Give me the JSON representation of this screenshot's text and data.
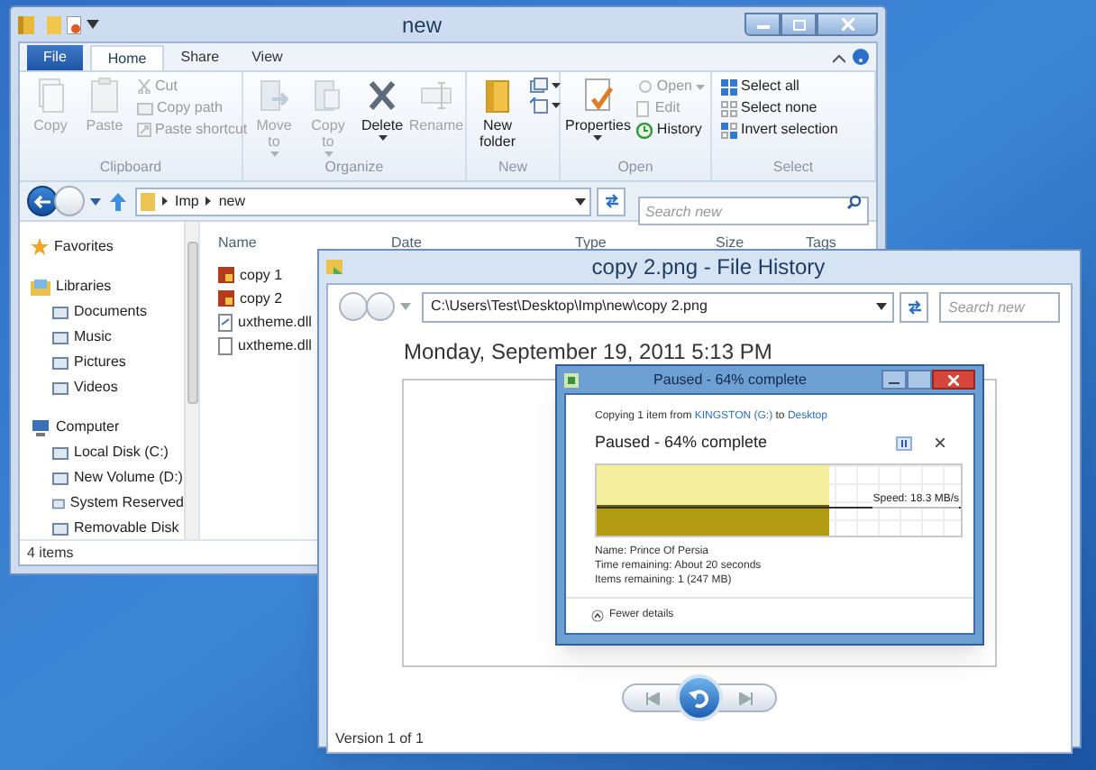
{
  "explorer": {
    "title": "new",
    "ribbon_tabs": [
      {
        "label": "File",
        "kind": "file",
        "selected": false
      },
      {
        "label": "Home",
        "kind": "tab",
        "selected": true
      },
      {
        "label": "Share",
        "kind": "tab",
        "selected": false
      },
      {
        "label": "View",
        "kind": "tab",
        "selected": false
      }
    ],
    "ribbon_groups": [
      {
        "label": "Clipboard",
        "commands": [
          {
            "label": "Copy",
            "kind": "large",
            "disabled": true
          },
          {
            "label": "Paste",
            "kind": "large",
            "disabled": true
          },
          {
            "label": "Cut",
            "kind": "small",
            "disabled": true
          },
          {
            "label": "Copy path",
            "kind": "small",
            "disabled": true
          },
          {
            "label": "Paste shortcut",
            "kind": "small",
            "disabled": true
          }
        ]
      },
      {
        "label": "Organize",
        "commands": [
          {
            "label": "Move to",
            "kind": "large",
            "disabled": true,
            "dropdown": true
          },
          {
            "label": "Copy to",
            "kind": "large",
            "disabled": true,
            "dropdown": true
          },
          {
            "label": "Delete",
            "kind": "large",
            "disabled": false,
            "dropdown": true
          },
          {
            "label": "Rename",
            "kind": "large",
            "disabled": true
          }
        ]
      },
      {
        "label": "New",
        "commands": [
          {
            "label": "New folder",
            "kind": "large",
            "disabled": false
          },
          {
            "kind": "icon",
            "disabled": false,
            "dropdown": true
          },
          {
            "kind": "icon",
            "disabled": false,
            "dropdown": true
          }
        ]
      },
      {
        "label": "Open",
        "commands": [
          {
            "label": "Properties",
            "kind": "large",
            "disabled": false,
            "dropdown": true
          },
          {
            "label": "Open",
            "kind": "small",
            "disabled": true,
            "dropdown": true
          },
          {
            "label": "Edit",
            "kind": "small",
            "disabled": true
          },
          {
            "label": "History",
            "kind": "small",
            "disabled": false
          }
        ]
      },
      {
        "label": "Select",
        "commands": [
          {
            "label": "Select all",
            "kind": "small",
            "disabled": false
          },
          {
            "label": "Select none",
            "kind": "small",
            "disabled": false
          },
          {
            "label": "Invert selection",
            "kind": "small",
            "disabled": false
          }
        ]
      }
    ],
    "breadcrumbs": [
      "Imp",
      "new"
    ],
    "search": {
      "placeholder": "Search new"
    },
    "nav_tree": [
      {
        "label": "Favorites"
      },
      {
        "label": "Libraries",
        "children": [
          {
            "label": "Documents"
          },
          {
            "label": "Music"
          },
          {
            "label": "Pictures"
          },
          {
            "label": "Videos"
          }
        ]
      },
      {
        "label": "Computer",
        "children": [
          {
            "label": "Local Disk (C:)"
          },
          {
            "label": "New Volume (D:)"
          },
          {
            "label": "System Reserved"
          },
          {
            "label": "Removable Disk"
          }
        ]
      }
    ],
    "columns": [
      "Name",
      "Date",
      "Type",
      "Size",
      "Tags"
    ],
    "files": [
      {
        "name": "copy 1",
        "kind": "image"
      },
      {
        "name": "copy 2",
        "kind": "image"
      },
      {
        "name": "uxtheme.dll",
        "kind": "dll"
      },
      {
        "name": "uxtheme.dll",
        "kind": "file"
      }
    ],
    "status_bar": "4 items"
  },
  "file_history": {
    "title": "copy 2.png - File History",
    "path": "C:\\Users\\Test\\Desktop\\Imp\\new\\copy 2.png",
    "search": {
      "placeholder": "Search new"
    },
    "date": "Monday, September 19, 2011 5:13 PM",
    "status": "Version 1 of 1"
  },
  "copy_dialog": {
    "title": "Paused - 64% complete",
    "summary": [
      {
        "text": "Copying 1 item from ",
        "kind": "text"
      },
      {
        "text": "KINGSTON (G:)",
        "kind": "link"
      },
      {
        "text": " to ",
        "kind": "text"
      },
      {
        "text": "Desktop",
        "kind": "link"
      }
    ],
    "heading": "Paused - 64% complete",
    "level": 0.64,
    "speed": "Speed: 18.3 MB/s",
    "details": [
      "Name: Prince Of Persia",
      "Time remaining: About 20 seconds",
      "Items remaining: 1 (247 MB)"
    ],
    "toggle": "Fewer details"
  }
}
